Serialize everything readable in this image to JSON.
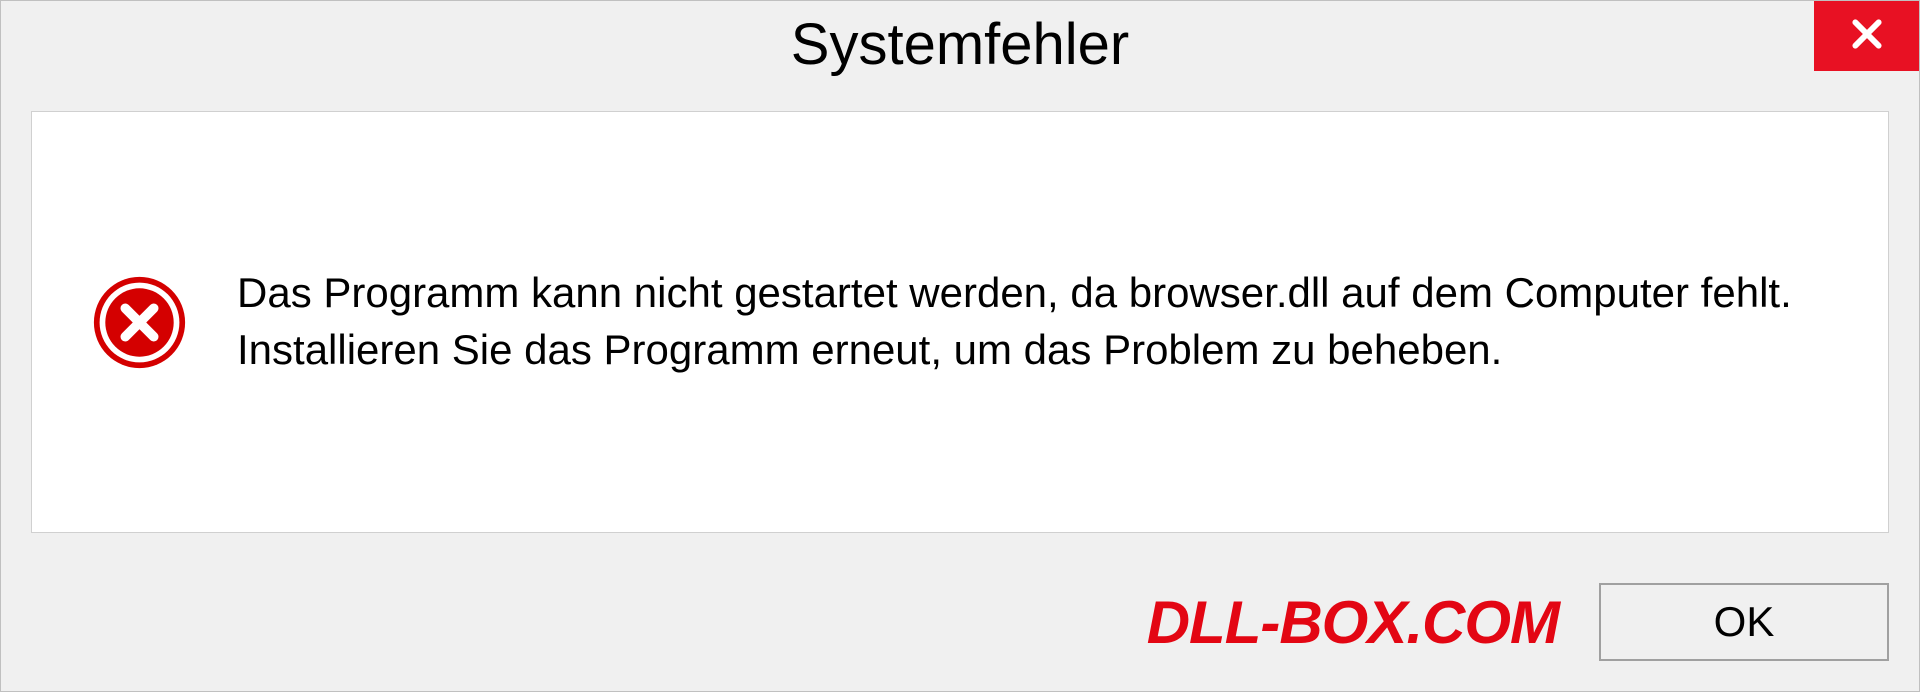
{
  "dialog": {
    "title": "Systemfehler",
    "message": "Das Programm kann nicht gestartet werden, da browser.dll auf dem Computer fehlt. Installieren Sie das Programm erneut, um das Problem zu beheben.",
    "ok_label": "OK"
  },
  "watermark": "DLL-BOX.COM"
}
